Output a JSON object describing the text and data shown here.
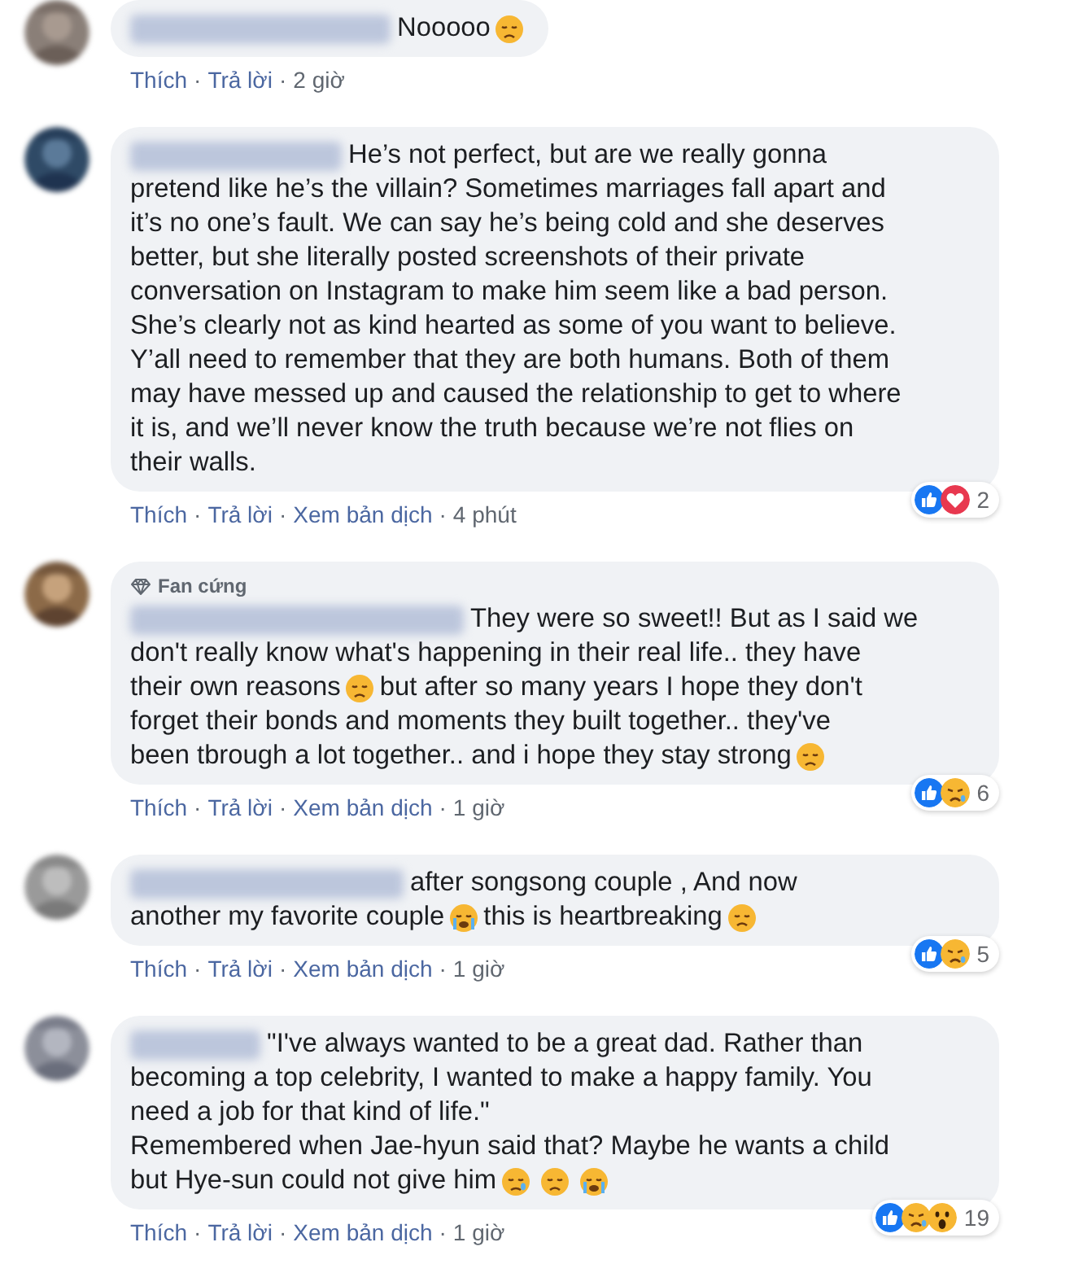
{
  "separator": "·",
  "comments": [
    {
      "lines": [
        [
          {
            "kind": "text",
            "text": "Nooooo"
          },
          {
            "kind": "sad-emoji"
          }
        ]
      ],
      "actions": [
        "Thích",
        "Trả lời"
      ],
      "time": "2 giờ"
    },
    {
      "lines": [
        [
          {
            "kind": "text",
            "text": "He’s not perfect, but are we really gonna"
          }
        ],
        [
          {
            "kind": "text",
            "text": "pretend like he’s the villain? Sometimes marriages fall apart and"
          }
        ],
        [
          {
            "kind": "text",
            "text": "it’s no one’s fault. We can say he’s being cold and she deserves"
          }
        ],
        [
          {
            "kind": "text",
            "text": "better, but she literally posted screenshots of their private"
          }
        ],
        [
          {
            "kind": "text",
            "text": "conversation on Instagram to make him seem like a bad person."
          }
        ],
        [
          {
            "kind": "text",
            "text": "She’s clearly not as kind hearted as some of you want to believe."
          }
        ],
        [
          {
            "kind": "text",
            "text": "Y’all need to remember that they are both humans. Both of them"
          }
        ],
        [
          {
            "kind": "text",
            "text": "may have messed up and caused the relationship to get to where"
          }
        ],
        [
          {
            "kind": "text",
            "text": "it is, and we’ll never know the truth because we’re not flies on"
          }
        ],
        [
          {
            "kind": "text",
            "text": "their walls."
          }
        ]
      ],
      "actions": [
        "Thích",
        "Trả lời",
        "Xem bản dịch"
      ],
      "time": "4 phút",
      "reactions": {
        "icons": [
          {
            "kind": "like"
          },
          {
            "kind": "love"
          }
        ],
        "count": "2"
      }
    },
    {
      "badge": "Fan cứng",
      "lines": [
        [
          {
            "kind": "text",
            "text": "They were so sweet!! But as I said we"
          }
        ],
        [
          {
            "kind": "text",
            "text": "don't really know what's happening in their real life.. they have"
          }
        ],
        [
          {
            "kind": "text",
            "text": "their own reasons"
          },
          {
            "kind": "sad-emoji"
          },
          {
            "kind": "text",
            "text": "but after so many years I hope they don't"
          }
        ],
        [
          {
            "kind": "text",
            "text": "forget their bonds and moments they built together.. they've"
          }
        ],
        [
          {
            "kind": "text",
            "text": "been tbrough a lot together.. and i hope they stay strong"
          },
          {
            "kind": "sad-emoji"
          }
        ]
      ],
      "actions": [
        "Thích",
        "Trả lời",
        "Xem bản dịch"
      ],
      "time": "1 giờ",
      "reactions": {
        "icons": [
          {
            "kind": "like"
          },
          {
            "kind": "sad"
          }
        ],
        "count": "6"
      }
    },
    {
      "lines": [
        [
          {
            "kind": "text",
            "text": "after songsong couple , And now"
          }
        ],
        [
          {
            "kind": "text",
            "text": "another my favorite couple"
          },
          {
            "kind": "crying-emoji"
          },
          {
            "kind": "text",
            "text": "this is heartbreaking"
          },
          {
            "kind": "frown-emoji"
          }
        ]
      ],
      "actions": [
        "Thích",
        "Trả lời",
        "Xem bản dịch"
      ],
      "time": "1 giờ",
      "reactions": {
        "icons": [
          {
            "kind": "like"
          },
          {
            "kind": "sad"
          }
        ],
        "count": "5"
      }
    },
    {
      "lines": [
        [
          {
            "kind": "text",
            "text": "\"I've always wanted to be a great dad. Rather than"
          }
        ],
        [
          {
            "kind": "text",
            "text": "becoming a top celebrity, I wanted to make a happy family. You"
          }
        ],
        [
          {
            "kind": "text",
            "text": "need a job for that kind of life.\""
          }
        ],
        [
          {
            "kind": "text",
            "text": "Remembered when Jae-hyun said that? Maybe he wants a child"
          }
        ],
        [
          {
            "kind": "text",
            "text": "but Hye-sun could not give him"
          },
          {
            "kind": "tear-emoji"
          },
          {
            "kind": "sad-emoji"
          },
          {
            "kind": "crying-emoji"
          }
        ]
      ],
      "actions": [
        "Thích",
        "Trả lời",
        "Xem bản dịch"
      ],
      "time": "1 giờ",
      "reactions": {
        "icons": [
          {
            "kind": "like"
          },
          {
            "kind": "sad"
          },
          {
            "kind": "wow"
          }
        ],
        "count": "19"
      }
    }
  ]
}
